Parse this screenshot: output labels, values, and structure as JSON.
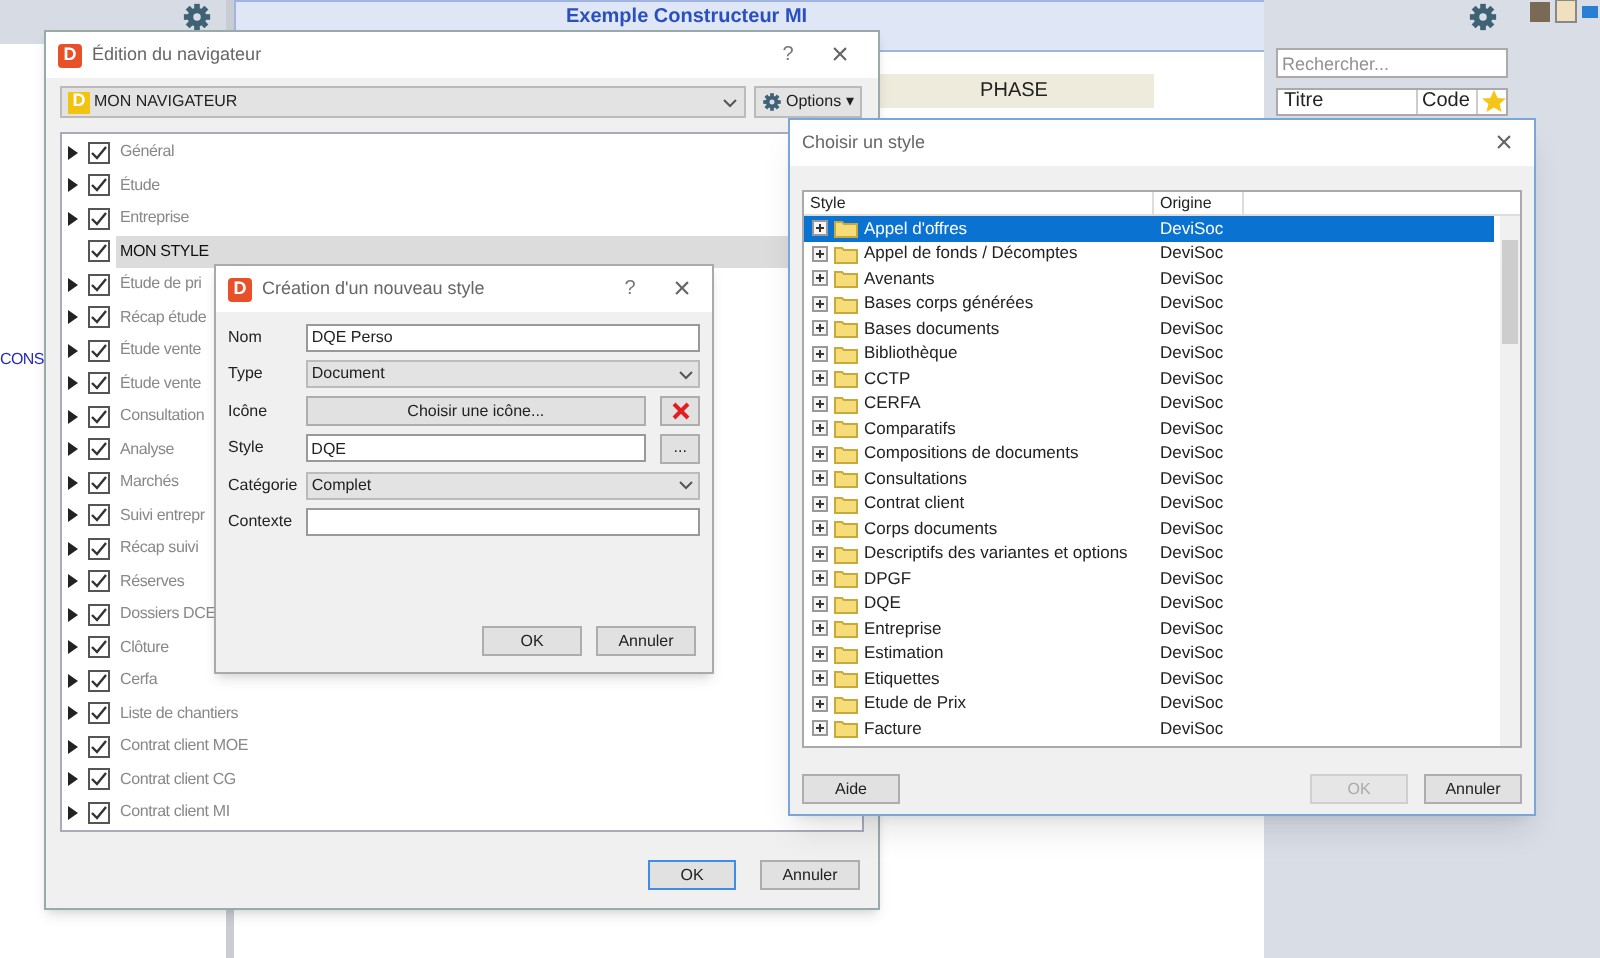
{
  "background": {
    "header_title": "Exemple Constructeur MI",
    "column_header": "PHASE",
    "side_text": "CONS",
    "search": {
      "placeholder": "Rechercher..."
    },
    "table_columns": [
      "Titre",
      "Code"
    ]
  },
  "navigator_window": {
    "badge": "D",
    "title": "Édition du navigateur",
    "help": "?",
    "close": "×",
    "navigator_select": {
      "badge": "D",
      "value": "MON NAVIGATEUR"
    },
    "options_button": "Options ▾",
    "items": [
      {
        "label": "Général",
        "checked": true,
        "expandable": true,
        "selected": false
      },
      {
        "label": "Étude",
        "checked": true,
        "expandable": true,
        "selected": false
      },
      {
        "label": "Entreprise",
        "checked": true,
        "expandable": true,
        "selected": false
      },
      {
        "label": "MON STYLE",
        "checked": true,
        "expandable": false,
        "selected": true
      },
      {
        "label": "Étude de pri",
        "checked": true,
        "expandable": true,
        "selected": false
      },
      {
        "label": "Récap étude",
        "checked": true,
        "expandable": true,
        "selected": false
      },
      {
        "label": "Étude vente",
        "checked": true,
        "expandable": true,
        "selected": false
      },
      {
        "label": "Étude vente",
        "checked": true,
        "expandable": true,
        "selected": false
      },
      {
        "label": "Consultation",
        "checked": true,
        "expandable": true,
        "selected": false
      },
      {
        "label": "Analyse",
        "checked": true,
        "expandable": true,
        "selected": false
      },
      {
        "label": "Marchés",
        "checked": true,
        "expandable": true,
        "selected": false
      },
      {
        "label": "Suivi entrepr",
        "checked": true,
        "expandable": true,
        "selected": false
      },
      {
        "label": "Récap suivi",
        "checked": true,
        "expandable": true,
        "selected": false
      },
      {
        "label": "Réserves",
        "checked": true,
        "expandable": true,
        "selected": false
      },
      {
        "label": "Dossiers DCE",
        "checked": true,
        "expandable": true,
        "selected": false
      },
      {
        "label": "Clôture",
        "checked": true,
        "expandable": true,
        "selected": false
      },
      {
        "label": "Cerfa",
        "checked": true,
        "expandable": true,
        "selected": false
      },
      {
        "label": "Liste de chantiers",
        "checked": true,
        "expandable": true,
        "selected": false
      },
      {
        "label": "Contrat client MOE",
        "checked": true,
        "expandable": true,
        "selected": false
      },
      {
        "label": "Contrat client CG",
        "checked": true,
        "expandable": true,
        "selected": false
      },
      {
        "label": "Contrat client MI",
        "checked": true,
        "expandable": true,
        "selected": false
      }
    ],
    "buttons": [
      "OK",
      "Annuler"
    ]
  },
  "new_style_dialog": {
    "badge": "D",
    "title": "Création d'un nouveau style",
    "help": "?",
    "close": "×",
    "fields": [
      {
        "kind": "text",
        "label": "Nom",
        "value": "DQE Perso"
      },
      {
        "kind": "select",
        "label": "Type",
        "value": "Document"
      },
      {
        "kind": "icon",
        "label": "Icône",
        "value": "Choisir une icône..."
      },
      {
        "kind": "browse",
        "label": "Style",
        "value": "DQE",
        "button": "..."
      },
      {
        "kind": "select",
        "label": "Catégorie",
        "value": "Complet"
      },
      {
        "kind": "text",
        "label": "Contexte"
      }
    ],
    "buttons": [
      "OK",
      "Annuler"
    ]
  },
  "choose_style_window": {
    "title": "Choisir un style",
    "close": "×",
    "columns": [
      "Style",
      "Origine"
    ],
    "rows": [
      {
        "style": "Appel d'offres",
        "origin": "DeviSoc",
        "selected": true
      },
      {
        "style": "Appel de fonds / Décomptes",
        "origin": "DeviSoc",
        "selected": false
      },
      {
        "style": "Avenants",
        "origin": "DeviSoc",
        "selected": false
      },
      {
        "style": "Bases corps générées",
        "origin": "DeviSoc",
        "selected": false
      },
      {
        "style": "Bases documents",
        "origin": "DeviSoc",
        "selected": false
      },
      {
        "style": "Bibliothèque",
        "origin": "DeviSoc",
        "selected": false
      },
      {
        "style": "CCTP",
        "origin": "DeviSoc",
        "selected": false
      },
      {
        "style": "CERFA",
        "origin": "DeviSoc",
        "selected": false
      },
      {
        "style": "Comparatifs",
        "origin": "DeviSoc",
        "selected": false
      },
      {
        "style": "Compositions de documents",
        "origin": "DeviSoc",
        "selected": false
      },
      {
        "style": "Consultations",
        "origin": "DeviSoc",
        "selected": false
      },
      {
        "style": "Contrat client",
        "origin": "DeviSoc",
        "selected": false
      },
      {
        "style": "Corps documents",
        "origin": "DeviSoc",
        "selected": false
      },
      {
        "style": "Descriptifs des variantes et options",
        "origin": "DeviSoc",
        "selected": false
      },
      {
        "style": "DPGF",
        "origin": "DeviSoc",
        "selected": false
      },
      {
        "style": "DQE",
        "origin": "DeviSoc",
        "selected": false
      },
      {
        "style": "Entreprise",
        "origin": "DeviSoc",
        "selected": false
      },
      {
        "style": "Estimation",
        "origin": "DeviSoc",
        "selected": false
      },
      {
        "style": "Etiquettes",
        "origin": "DeviSoc",
        "selected": false
      },
      {
        "style": "Etude de Prix",
        "origin": "DeviSoc",
        "selected": false
      },
      {
        "style": "Facture",
        "origin": "DeviSoc",
        "selected": false
      }
    ],
    "buttons": [
      {
        "label": "Aide",
        "disabled": false
      },
      {
        "label": "OK",
        "disabled": true
      },
      {
        "label": "Annuler",
        "disabled": false
      }
    ]
  }
}
